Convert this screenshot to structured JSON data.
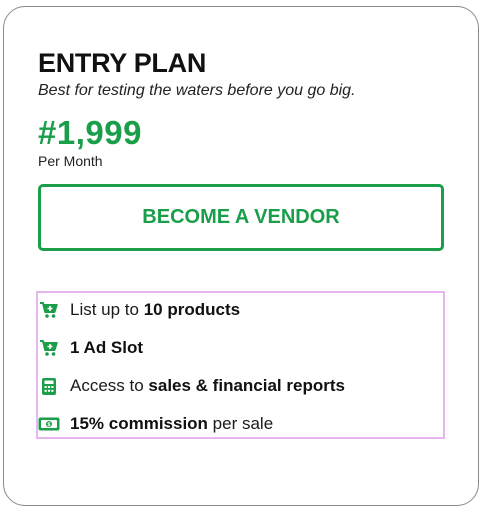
{
  "plan": {
    "name": "ENTRY PLAN",
    "tagline": "Best for testing the waters before you go big.",
    "price": "#1,999",
    "period": "Per Month",
    "cta_label": "BECOME A VENDOR"
  },
  "features": [
    {
      "icon": "cart-plus-icon",
      "prefix": "List up to ",
      "bold": "10 products",
      "suffix": ""
    },
    {
      "icon": "cart-plus-icon",
      "prefix": "",
      "bold": "1 Ad Slot",
      "suffix": ""
    },
    {
      "icon": "calculator-icon",
      "prefix": "Access to ",
      "bold": "sales & financial reports",
      "suffix": ""
    },
    {
      "icon": "money-bill-icon",
      "prefix": "",
      "bold": "15% commission",
      "suffix": " per sale"
    }
  ],
  "colors": {
    "accent": "#1a9e49",
    "features_outline": "#e7b6ee",
    "card_border": "#8a8a8a"
  }
}
